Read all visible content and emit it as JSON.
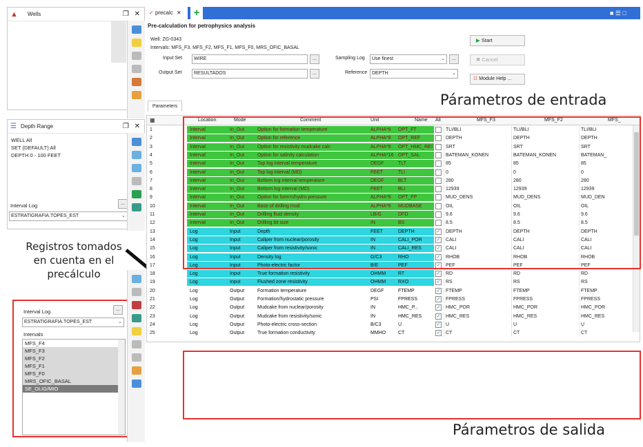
{
  "wells_panel": {
    "title": "Wells"
  },
  "depth_panel": {
    "title": "Depth Range",
    "items": [
      "WELL All",
      "SET (DEFAULT) All",
      "DEPTH 0 - 100 FEET"
    ]
  },
  "interval_log_top": {
    "label": "Interval Log",
    "value": "ESTRATIGRAFIA.TOPES_EST"
  },
  "interval_log_bottom": {
    "label": "Interval Log",
    "value": "ESTRATIGRAFIA.TOPES_EST",
    "intervals_label": "Intervals",
    "intervals": [
      "MFS_F4",
      "MFS_F3",
      "MFS_F2",
      "MFS_F1",
      "MFS_F0",
      "MRS_OFIC_BASAL",
      "SE_OLIG/MIO"
    ]
  },
  "main": {
    "tab_label": "precalc",
    "title": "Pre-calculation for petrophysics analysis",
    "well_line": "Well: ZG-0343",
    "intervals_line": "Intervals: MFS_F3, MFS_F2, MFS_F1, MFS_F0, MRS_OFIC_BASAL",
    "input_set_label": "Input Set",
    "input_set_value": "WIRE",
    "output_set_label": "Output Set",
    "output_set_value": "RESULTADOS",
    "sampling_log_label": "Sampling Log",
    "sampling_log_value": "Use finest",
    "reference_label": "Reference",
    "reference_value": "DEPTH",
    "start_label": "Start",
    "cancel_label": "Cancel",
    "module_help_label": "Module Help ...",
    "parameters_tab": "Parameters"
  },
  "grid": {
    "headers": [
      "Location",
      "Mode",
      "Comment",
      "Unit",
      "Name",
      "All",
      "MFS_F3",
      "MFS_F2",
      "MFS_"
    ],
    "rows": [
      {
        "n": "1",
        "loc": "Interval",
        "mode": "In_Out",
        "comment": "Option for formation temperature",
        "unit": "ALPHA*8",
        "name": "OPT_FT",
        "all": false,
        "v1": "TLI/BLI",
        "v2": "TLI/BLI",
        "v3": "TLI/BLI"
      },
      {
        "n": "2",
        "loc": "Interval",
        "mode": "In_Out",
        "comment": "Option for reference",
        "unit": "ALPHA*8",
        "name": "OPT_REF",
        "all": false,
        "v1": "DEPTH",
        "v2": "DEPTH",
        "v3": "DEPTH"
      },
      {
        "n": "3",
        "loc": "Interval",
        "mode": "In_Out",
        "comment": "Option for resistivity mudcake calc",
        "unit": "ALPHA*8",
        "name": "OPT_HMC_RES",
        "all": false,
        "v1": "SRT",
        "v2": "SRT",
        "v3": "SRT"
      },
      {
        "n": "4",
        "loc": "Interval",
        "mode": "In_Out",
        "comment": "Option for salinity calculation",
        "unit": "ALPHA*16",
        "name": "OPT_SAL",
        "all": false,
        "v1": "BATEMAN_KONEN",
        "v2": "BATEMAN_KONEN",
        "v3": "BATEMAN_"
      },
      {
        "n": "5",
        "loc": "Interval",
        "mode": "In_Out",
        "comment": "Top log interval temperature",
        "unit": "DEGF",
        "name": "TLT",
        "all": false,
        "v1": "85",
        "v2": "85",
        "v3": "85"
      },
      {
        "n": "6",
        "loc": "Interval",
        "mode": "In_Out",
        "comment": "Top log interval (MD)",
        "unit": "FEET",
        "name": "TLI",
        "all": false,
        "v1": "0",
        "v2": "0",
        "v3": "0"
      },
      {
        "n": "7",
        "loc": "Interval",
        "mode": "In_Out",
        "comment": "Bottom log interval temperature",
        "unit": "DEGF",
        "name": "BLT",
        "all": false,
        "v1": "280",
        "v2": "280",
        "v3": "280"
      },
      {
        "n": "8",
        "loc": "Interval",
        "mode": "In_Out",
        "comment": "Bottom log interval (MD)",
        "unit": "FEET",
        "name": "BLI",
        "all": false,
        "v1": "12939",
        "v2": "12939",
        "v3": "12939"
      },
      {
        "n": "9",
        "loc": "Interval",
        "mode": "In_Out",
        "comment": "Option for form'n/hydro pressure",
        "unit": "ALPHA*8",
        "name": "OPT_FP",
        "all": false,
        "v1": "MUD_DENS",
        "v2": "MUD_DENS",
        "v3": "MUD_DEN"
      },
      {
        "n": "10",
        "loc": "Interval",
        "mode": "In_Out",
        "comment": "Base of drilling mud",
        "unit": "ALPHA*8",
        "name": "MUDBASE",
        "all": false,
        "v1": "OIL",
        "v2": "OIL",
        "v3": "OIL"
      },
      {
        "n": "11",
        "loc": "Interval",
        "mode": "In_Out",
        "comment": "Drilling fluid density",
        "unit": "LB/G",
        "name": "DFD",
        "all": false,
        "v1": "9.6",
        "v2": "9.6",
        "v3": "9.6"
      },
      {
        "n": "12",
        "loc": "Interval",
        "mode": "In_Out",
        "comment": "Drilling bit size",
        "unit": "IN",
        "name": "BS",
        "all": false,
        "v1": "8.5",
        "v2": "8.5",
        "v3": "8.5"
      },
      {
        "n": "13",
        "loc": "Log",
        "mode": "Input",
        "comment": "Depth",
        "unit": "FEET",
        "name": "DEPTH",
        "all": true,
        "v1": "DEPTH",
        "v2": "DEPTH",
        "v3": "DEPTH"
      },
      {
        "n": "14",
        "loc": "Log",
        "mode": "Input",
        "comment": "Caliper from nuclear/porosity",
        "unit": "IN",
        "name": "CALI_POR",
        "all": true,
        "v1": "CALI",
        "v2": "CALI",
        "v3": "CALI"
      },
      {
        "n": "15",
        "loc": "Log",
        "mode": "Input",
        "comment": "Caliper from resistivity/sonic",
        "unit": "IN",
        "name": "CALI_RES",
        "all": true,
        "v1": "CALI",
        "v2": "CALI",
        "v3": "CALI"
      },
      {
        "n": "16",
        "loc": "Log",
        "mode": "Input",
        "comment": "Density log",
        "unit": "G/C3",
        "name": "RHO",
        "all": true,
        "v1": "RHOB",
        "v2": "RHOB",
        "v3": "RHOB"
      },
      {
        "n": "17",
        "loc": "Log",
        "mode": "Input",
        "comment": "Photo-electric factor",
        "unit": "B/E",
        "name": "PEF",
        "all": true,
        "v1": "PEF",
        "v2": "PEF",
        "v3": "PEF"
      },
      {
        "n": "18",
        "loc": "Log",
        "mode": "Input",
        "comment": "True formation resistivity",
        "unit": "OHMM",
        "name": "RT",
        "all": true,
        "v1": "RD",
        "v2": "RD",
        "v3": "RD"
      },
      {
        "n": "19",
        "loc": "Log",
        "mode": "Input",
        "comment": "Flushed zone resistivity",
        "unit": "OHMM",
        "name": "RXO",
        "all": true,
        "v1": "RS",
        "v2": "RS",
        "v3": "RS"
      },
      {
        "n": "20",
        "loc": "Log",
        "mode": "Output",
        "comment": "Formation temperature",
        "unit": "DEGF",
        "name": "FTEMP",
        "all": true,
        "v1": "FTEMP",
        "v2": "FTEMP",
        "v3": "FTEMP"
      },
      {
        "n": "21",
        "loc": "Log",
        "mode": "Output",
        "comment": "Formation/hydrostatic pressure",
        "unit": "PSI",
        "name": "FPRESS",
        "all": true,
        "v1": "FPRESS",
        "v2": "FPRESS",
        "v3": "FPRESS"
      },
      {
        "n": "22",
        "loc": "Log",
        "mode": "Output",
        "comment": "Mudcake from nuclear/porosity",
        "unit": "IN",
        "name": "HMC_P...",
        "all": true,
        "v1": "HMC_POR",
        "v2": "HMC_POR",
        "v3": "HMC_POR"
      },
      {
        "n": "23",
        "loc": "Log",
        "mode": "Output",
        "comment": "Mudcake from resistivity/sonic",
        "unit": "IN",
        "name": "HMC_RES",
        "all": true,
        "v1": "HMC_RES",
        "v2": "HMC_RES",
        "v3": "HMC_RES"
      },
      {
        "n": "24",
        "loc": "Log",
        "mode": "Output",
        "comment": "Photo-electric cross-section",
        "unit": "B/C3",
        "name": "U",
        "all": true,
        "v1": "U",
        "v2": "U",
        "v3": "U"
      },
      {
        "n": "25",
        "loc": "Log",
        "mode": "Output",
        "comment": "True formation conductivity",
        "unit": "MMHO",
        "name": "CT",
        "all": true,
        "v1": "CT",
        "v2": "CT",
        "v3": "CT"
      }
    ]
  },
  "annotations": {
    "input_params": "Párametros de entrada",
    "output_params": "Párametros de salida",
    "logs_line1": "Registros tomados",
    "logs_line2": "en cuenta en el",
    "logs_line3": "precálculo"
  },
  "colors": {
    "interval_green": "#3fc63f",
    "log_cyan": "#2fd5e0",
    "accent_red": "#e8302b",
    "titlebar_blue": "#2f6fd6"
  }
}
